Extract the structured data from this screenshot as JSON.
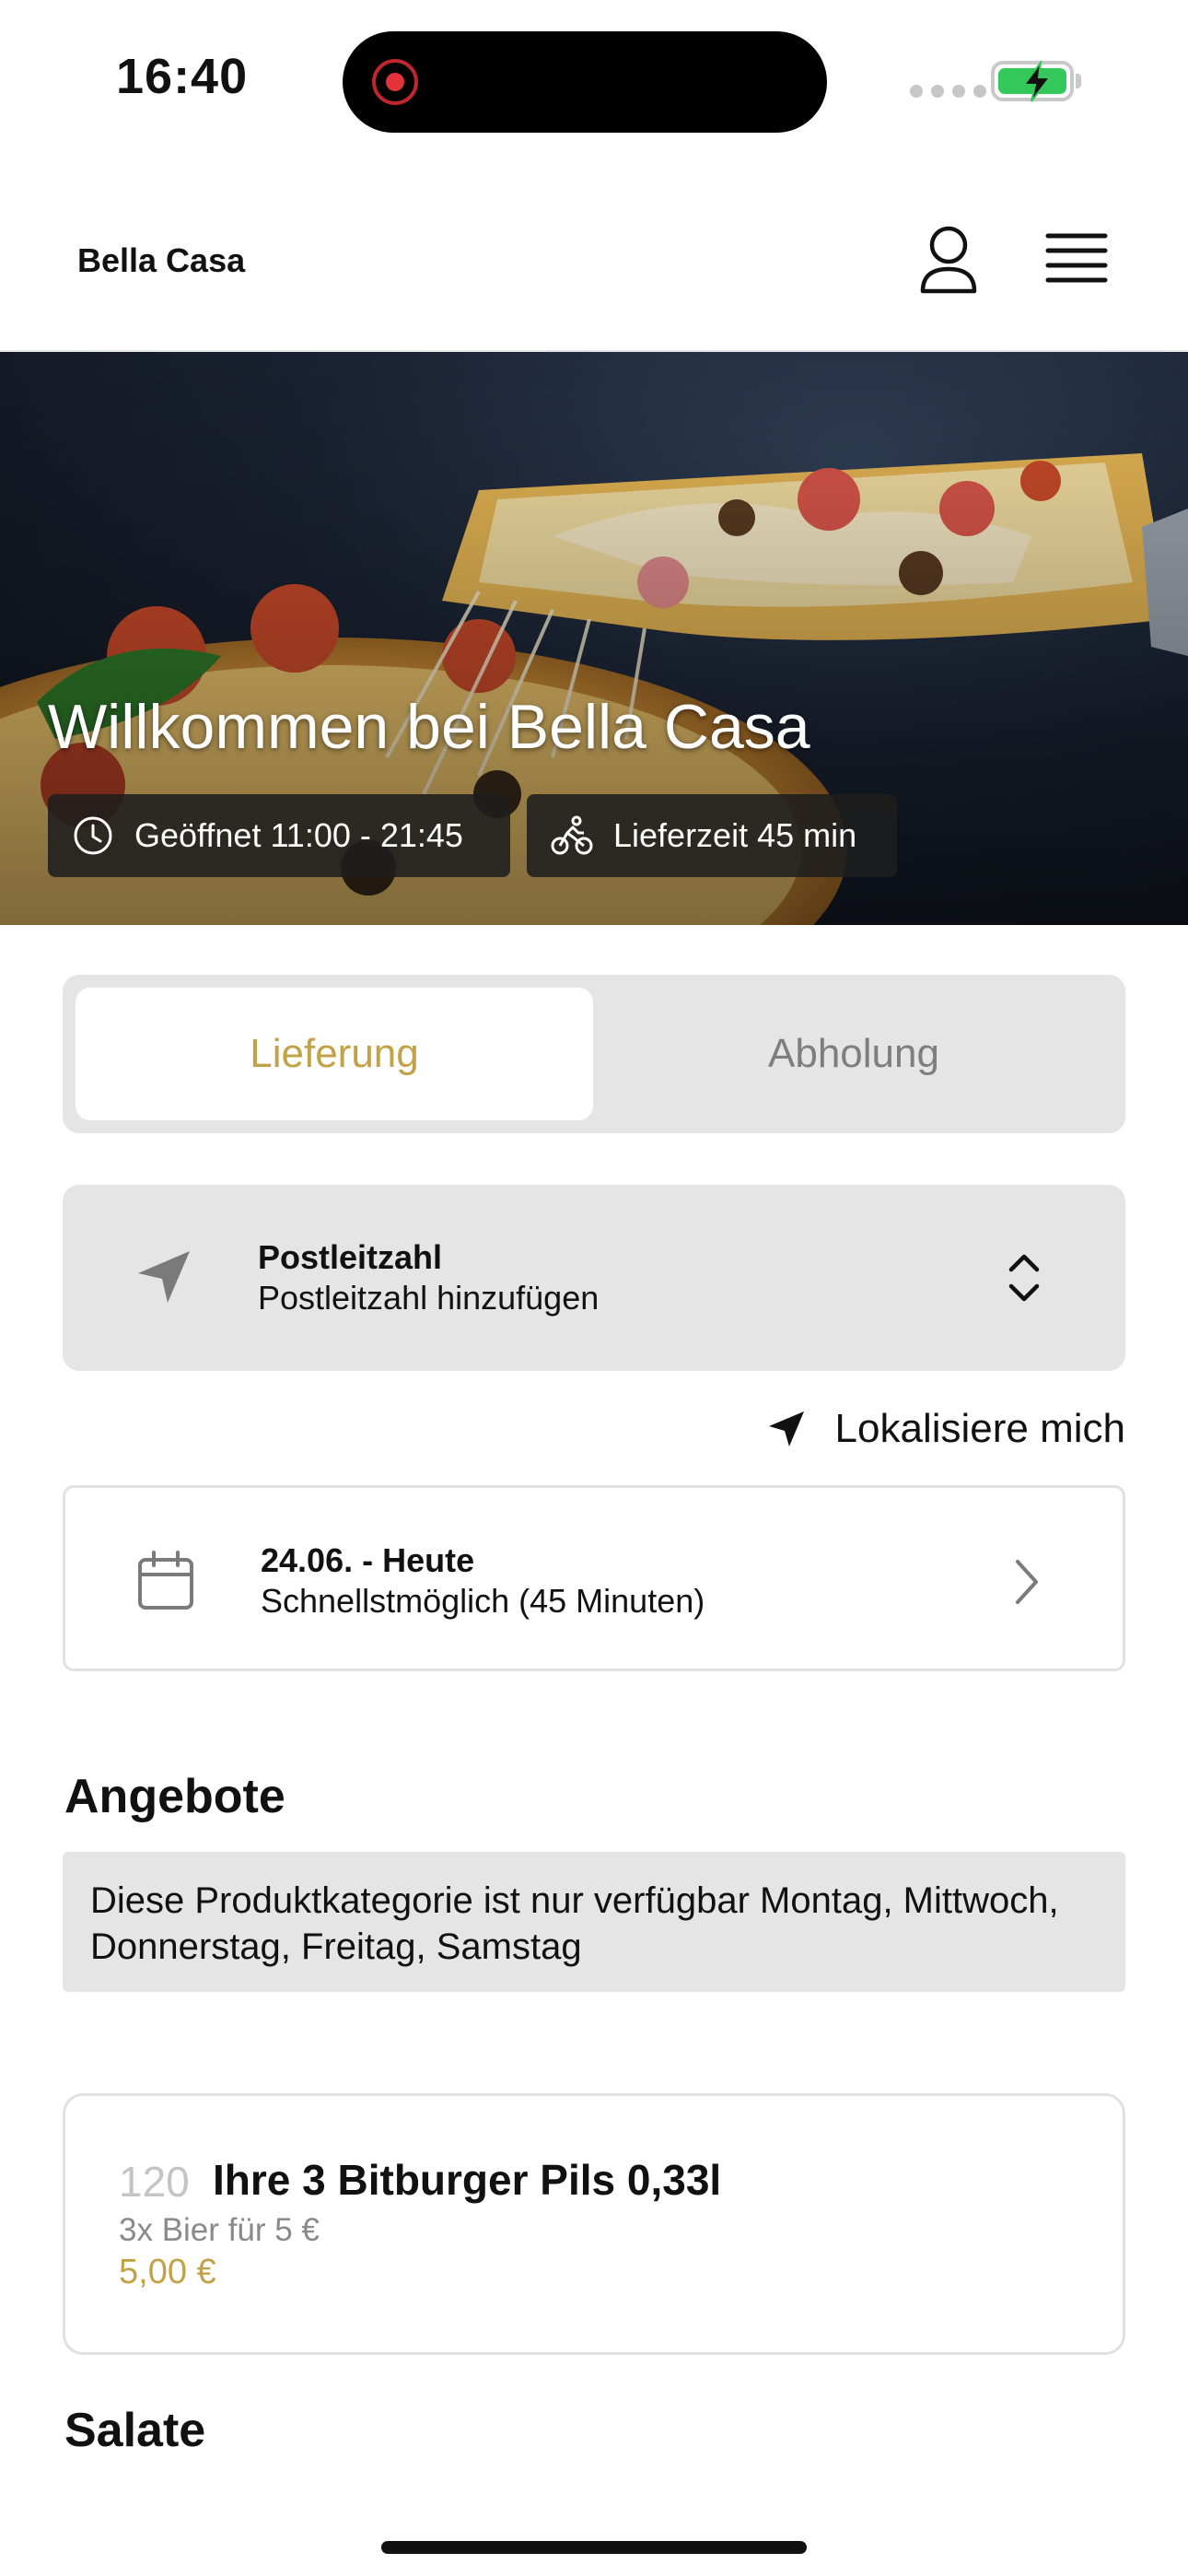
{
  "status_bar": {
    "time": "16:40"
  },
  "header": {
    "brand": "Bella Casa"
  },
  "hero": {
    "title": "Willkommen bei Bella Casa",
    "opening_hours": "Geöffnet 11:00 - 21:45",
    "delivery_time": "Lieferzeit 45 min"
  },
  "mode_toggle": {
    "delivery_label": "Lieferung",
    "pickup_label": "Abholung",
    "selected": "Lieferung"
  },
  "postcode": {
    "label": "Postleitzahl",
    "placeholder": "Postleitzahl hinzufügen"
  },
  "locate": {
    "label": "Lokalisiere mich"
  },
  "date": {
    "label": "24.06. - Heute",
    "value": "Schnellstmöglich (45 Minuten)"
  },
  "sections": {
    "angebote": {
      "title": "Angebote",
      "notice": "Diese Produktkategorie ist nur verfügbar Montag, Mittwoch, Donnerstag, Freitag, Samstag"
    },
    "salate": {
      "title": "Salate"
    }
  },
  "products": [
    {
      "number": "120",
      "name": "Ihre 3 Bitburger Pils 0,33l",
      "description": "3x Bier für 5 €",
      "price": "5,00 €"
    }
  ],
  "colors": {
    "accent": "#c2a247",
    "panel": "#e5e5e5",
    "battery": "#34c759"
  },
  "icons": [
    "user-icon",
    "menu-icon",
    "clock-icon",
    "bike-icon",
    "location-arrow-icon",
    "calendar-icon",
    "chevron-right-icon",
    "chevron-up-down-icon"
  ]
}
